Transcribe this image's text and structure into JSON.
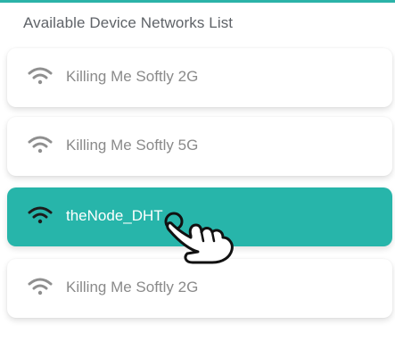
{
  "header": {
    "title": "Available Device Networks List"
  },
  "colors": {
    "accent": "#27b5aa",
    "card_background": "#ffffff",
    "ssid_text": "#8a8a8a",
    "title_text": "#5f6368"
  },
  "networks": [
    {
      "ssid": "Killing Me Softly 2G",
      "icon": "wifi-icon",
      "selected": false
    },
    {
      "ssid": "Killing Me Softly 5G",
      "icon": "wifi-icon",
      "selected": false
    },
    {
      "ssid": "theNode_DHT",
      "icon": "wifi-icon",
      "selected": true
    },
    {
      "ssid": "Killing Me Softly 2G",
      "icon": "wifi-icon",
      "selected": false
    }
  ],
  "cursor": {
    "icon": "hand-pointer-icon"
  }
}
